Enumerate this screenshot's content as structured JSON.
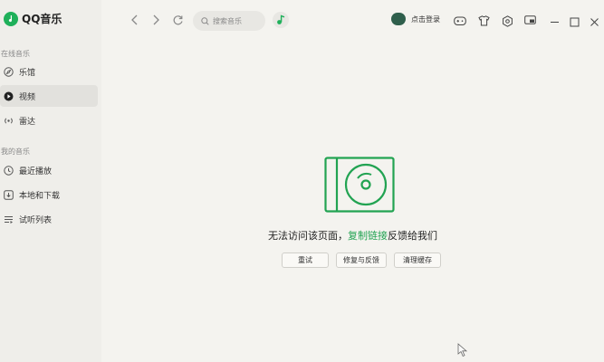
{
  "app": {
    "name": "QQ音乐"
  },
  "sidebar": {
    "online_label": "在线音乐",
    "online_items": [
      {
        "label": "乐馆",
        "icon": "compass-icon"
      },
      {
        "label": "视频",
        "icon": "play-icon"
      },
      {
        "label": "雷达",
        "icon": "radar-icon"
      }
    ],
    "mine_label": "我的音乐",
    "mine_items": [
      {
        "label": "最近播放",
        "icon": "clock-icon"
      },
      {
        "label": "本地和下载",
        "icon": "download-icon"
      },
      {
        "label": "试听列表",
        "icon": "list-icon"
      }
    ],
    "active_item": "视频"
  },
  "topbar": {
    "search_placeholder": "搜索音乐",
    "login_label": "点击登录"
  },
  "error": {
    "message_before": "无法访问该页面，",
    "message_link": "复制链接",
    "message_after": "反馈给我们",
    "buttons": {
      "retry": "重试",
      "repair": "修复与反馈",
      "clear_cache": "清理缓存"
    }
  },
  "colors": {
    "accent": "#22a352",
    "background": "#f4f3ef",
    "sidebar": "#efeeea"
  }
}
